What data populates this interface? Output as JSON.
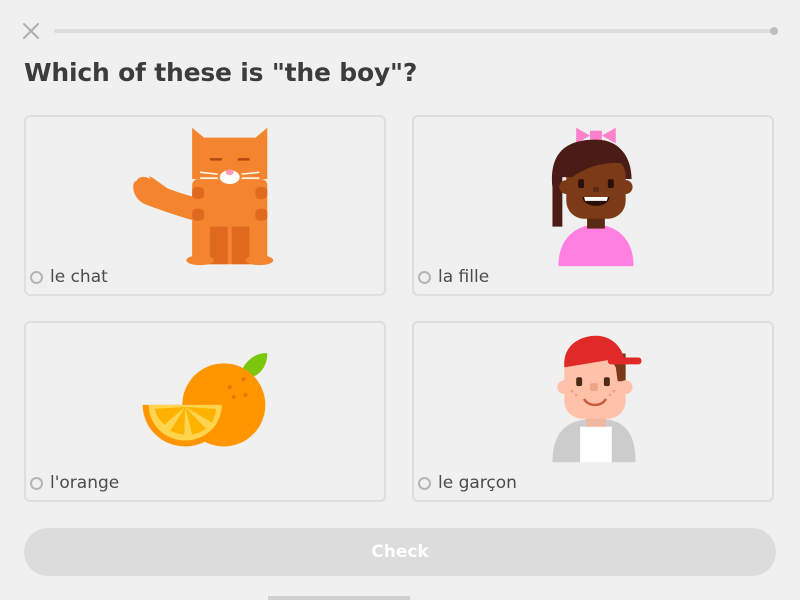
{
  "header": {
    "close_icon": "close-icon",
    "progress": 0
  },
  "prompt": "Which of these is \"the boy\"?",
  "options": [
    {
      "label": "le chat",
      "icon": "cat-illustration"
    },
    {
      "label": "la fille",
      "icon": "girl-illustration"
    },
    {
      "label": "l'orange",
      "icon": "orange-illustration"
    },
    {
      "label": "le garçon",
      "icon": "boy-illustration"
    }
  ],
  "check_button": {
    "label": "Check",
    "disabled": true
  },
  "colors": {
    "background": "#f0f0f0",
    "card_border": "#dedede",
    "button_disabled": "#dcdcdc",
    "progress_track": "#dcdcdc"
  }
}
